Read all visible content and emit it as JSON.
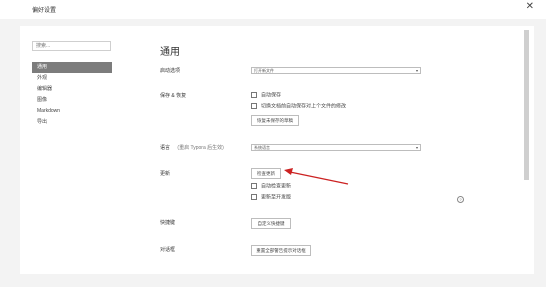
{
  "window": {
    "title": "偏好设置",
    "close_glyph": "✕"
  },
  "search": {
    "placeholder": "搜索..."
  },
  "nav": {
    "items": [
      {
        "label": "通用",
        "active": true
      },
      {
        "label": "外观"
      },
      {
        "label": "编辑器"
      },
      {
        "label": "图像"
      },
      {
        "label": "Markdown"
      },
      {
        "label": "导出"
      }
    ]
  },
  "section": {
    "title": "通用"
  },
  "startup": {
    "label": "启动选项",
    "value": "打开新文件"
  },
  "save": {
    "label": "保存 & 恢复",
    "option1": "自动保存",
    "option2": "切换文档前自动保存对上个文件的修改",
    "button": "恢复未保存的草稿"
  },
  "language": {
    "label": "语言",
    "hint": "(重启 Typora 后生效)",
    "value": "系统语言"
  },
  "update": {
    "label": "更新",
    "button": "检查更新",
    "option1": "自动检查更新",
    "option2": "更新至开发版",
    "help": "?"
  },
  "shortcuts": {
    "label": "快捷键",
    "button": "自定义快捷键"
  },
  "dialogs": {
    "label": "对话框",
    "button": "重置全部警告提示对话框"
  },
  "colors": {
    "accent": "#cc2222",
    "nav_active": "#7c7c7c"
  }
}
